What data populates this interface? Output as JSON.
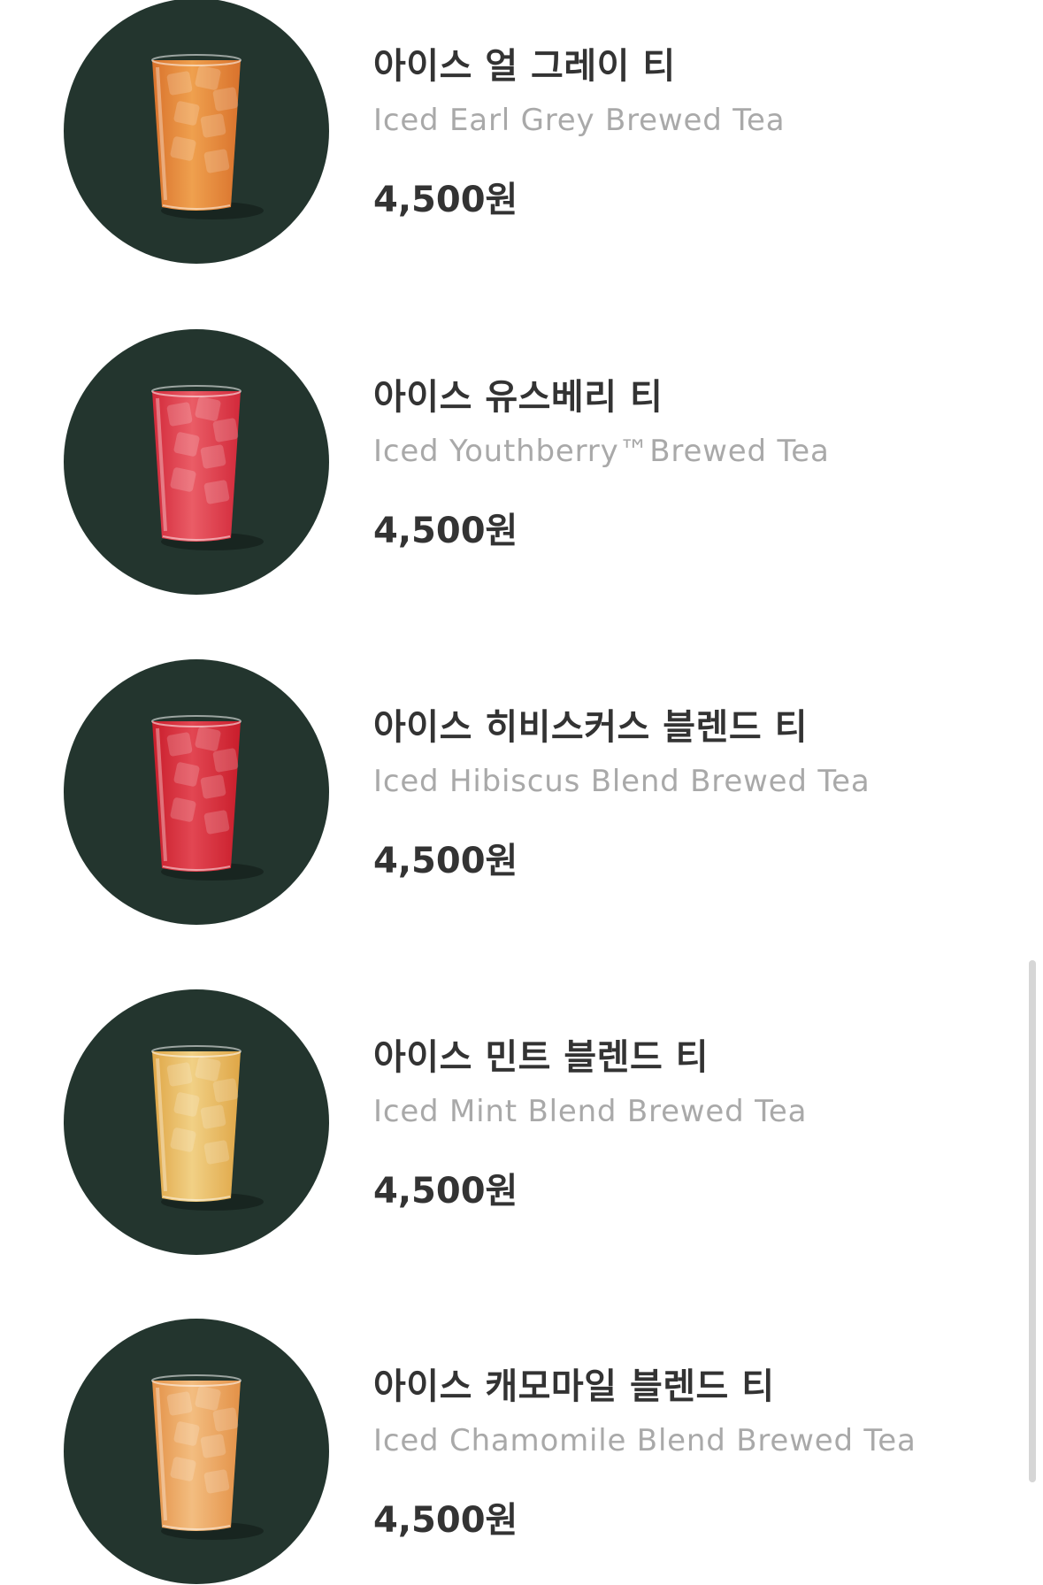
{
  "menu": {
    "items": [
      {
        "name_ko": "아이스 얼 그레이 티",
        "name_en": "Iced Earl Grey Brewed Tea",
        "price": "4,500원",
        "drink_color": "#d9722c",
        "drink_color_light": "#efa04e",
        "icon": "iced-tea-glass"
      },
      {
        "name_ko": "아이스 유스베리 티",
        "name_en": "Iced Youthberry™Brewed Tea",
        "price": "4,500원",
        "drink_color": "#d2293a",
        "drink_color_light": "#ea5c66",
        "icon": "iced-tea-glass"
      },
      {
        "name_ko": "아이스 히비스커스 블렌드 티",
        "name_en": "Iced Hibiscus Blend Brewed Tea",
        "price": "4,500원",
        "drink_color": "#c91d2b",
        "drink_color_light": "#e24652",
        "icon": "iced-tea-glass"
      },
      {
        "name_ko": "아이스 민트 블렌드 티",
        "name_en": "Iced Mint Blend Brewed Tea",
        "price": "4,500원",
        "drink_color": "#dfa646",
        "drink_color_light": "#f1d085",
        "icon": "iced-tea-glass"
      },
      {
        "name_ko": "아이스 캐모마일 블렌드 티",
        "name_en": "Iced Chamomile Blend Brewed Tea",
        "price": "4,500원",
        "drink_color": "#e39147",
        "drink_color_light": "#f3bd80",
        "icon": "iced-tea-glass"
      }
    ]
  },
  "colors": {
    "thumb_background": "#23352e",
    "title_text": "#333333",
    "subtitle_text": "#a9a9a9"
  }
}
